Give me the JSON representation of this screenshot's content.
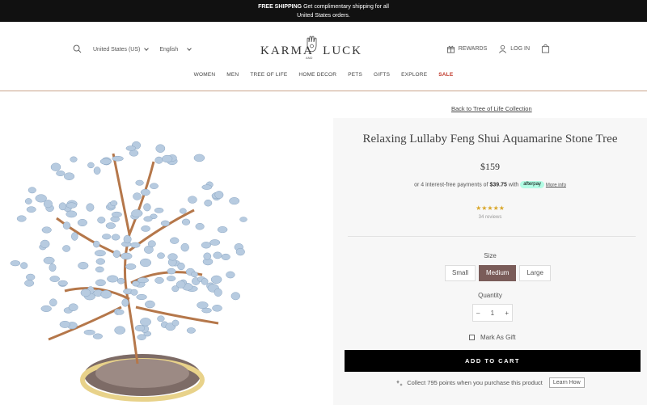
{
  "promo": {
    "bold": "FREE SHIPPING",
    "text": " Get complimentary shipping for all",
    "line2": "United States orders."
  },
  "header": {
    "country": "United States (US)",
    "language": "English",
    "logo_left": "KARMA",
    "logo_right": "LUCK",
    "logo_and": "AND",
    "rewards": "REWARDS",
    "login": "LOG IN"
  },
  "nav": [
    "WOMEN",
    "MEN",
    "TREE OF LIFE",
    "HOME DECOR",
    "PETS",
    "GIFTS",
    "EXPLORE",
    "SALE"
  ],
  "product": {
    "back_link": "Back to Tree of Life Collection",
    "title": "Relaxing Lullaby Feng Shui Aquamarine Stone Tree",
    "price": "$159",
    "afterpay_pre": "or 4 interest-free payments of ",
    "afterpay_amount": "$39.75",
    "afterpay_with": " with ",
    "afterpay_badge": "afterpay",
    "afterpay_more": "More info",
    "stars": "★★★★★",
    "rating": 5,
    "reviews": "34 reviews",
    "size_label": "Size",
    "sizes": [
      "Small",
      "Medium",
      "Large"
    ],
    "selected_size": "Medium",
    "quantity_label": "Quantity",
    "quantity": "1",
    "minus": "–",
    "plus": "+",
    "gift_label": "Mark As Gift",
    "add_to_cart": "ADD TO CART",
    "points_text": "Collect 795 points when you purchase this product",
    "learn_how": "Learn How"
  },
  "colors": {
    "accent": "#7a5c59",
    "sale": "#c0392b",
    "stars": "#d9a72a",
    "afterpay": "#b2fce4"
  }
}
